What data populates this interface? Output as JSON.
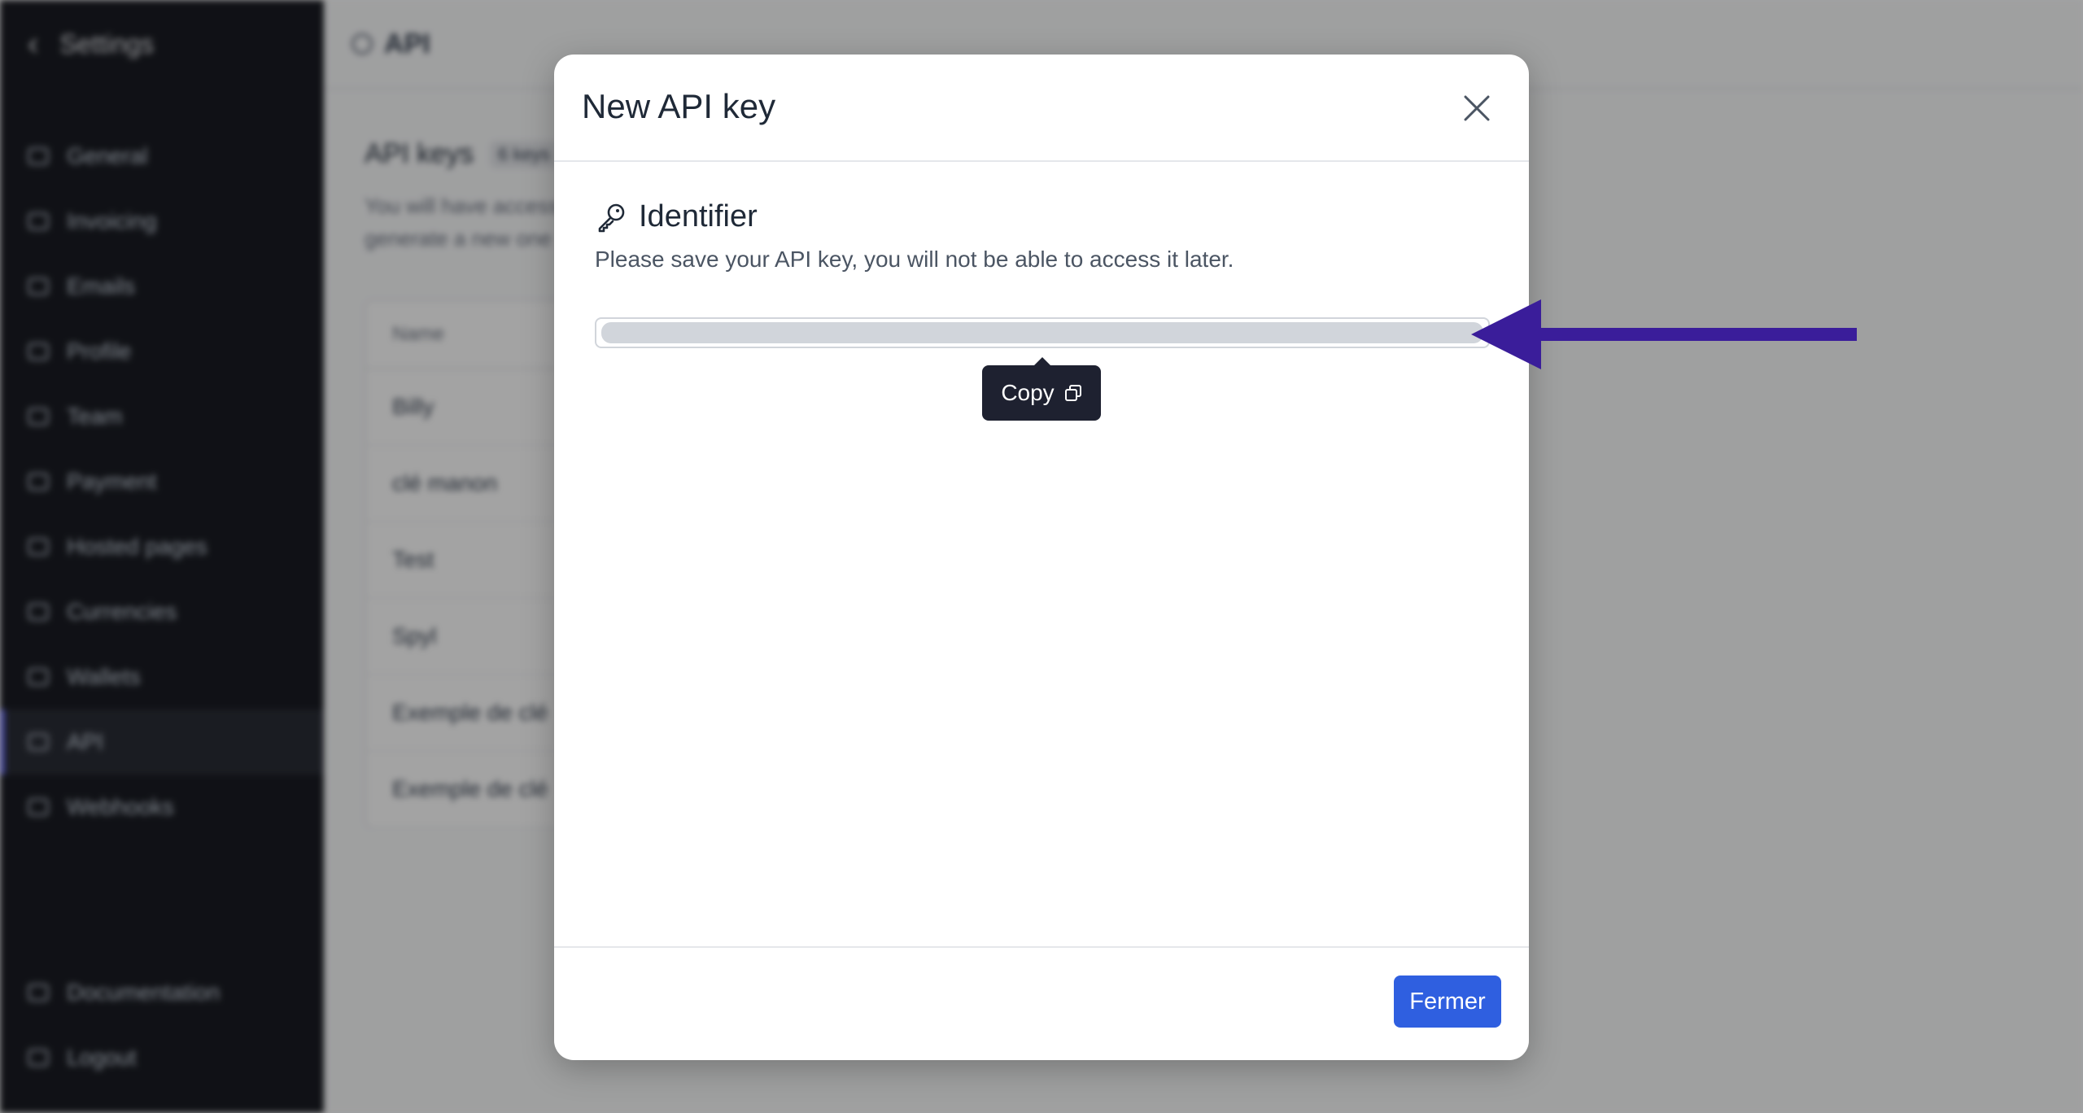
{
  "sidebar": {
    "back_icon": "chevron-left-icon",
    "title": "Settings",
    "items": [
      {
        "label": "General",
        "icon": "building-icon"
      },
      {
        "label": "Invoicing",
        "icon": "document-icon"
      },
      {
        "label": "Emails",
        "icon": "mail-icon"
      },
      {
        "label": "Profile",
        "icon": "user-icon"
      },
      {
        "label": "Team",
        "icon": "team-icon"
      },
      {
        "label": "Payment",
        "icon": "card-icon"
      },
      {
        "label": "Hosted pages",
        "icon": "pages-icon"
      },
      {
        "label": "Currencies",
        "icon": "coins-icon"
      },
      {
        "label": "Wallets",
        "icon": "wallet-icon"
      },
      {
        "label": "API",
        "icon": "api-icon",
        "active": true
      },
      {
        "label": "Webhooks",
        "icon": "bell-icon"
      }
    ],
    "footer": [
      {
        "label": "Documentation",
        "icon": "book-icon"
      },
      {
        "label": "Logout",
        "icon": "logout-icon"
      }
    ],
    "active_color": "#6366f1"
  },
  "main": {
    "page_title": "API",
    "section_title": "API keys",
    "section_badge": "6 keys",
    "description_line1": "You will have access",
    "description_line2": "generate a new one",
    "table": {
      "header": "Name",
      "rows": [
        "Billy",
        "clé manon",
        "Test",
        "Spyl",
        "Exemple de clé",
        "Exemple de clé"
      ]
    }
  },
  "modal": {
    "title": "New API key",
    "identifier_label": "Identifier",
    "notice": "Please save your API key, you will not be able to access it later.",
    "copy_label": "Copy",
    "close_button": "Fermer",
    "accent": "#2f5fe0",
    "arrow_color": "#3a1d9a"
  }
}
